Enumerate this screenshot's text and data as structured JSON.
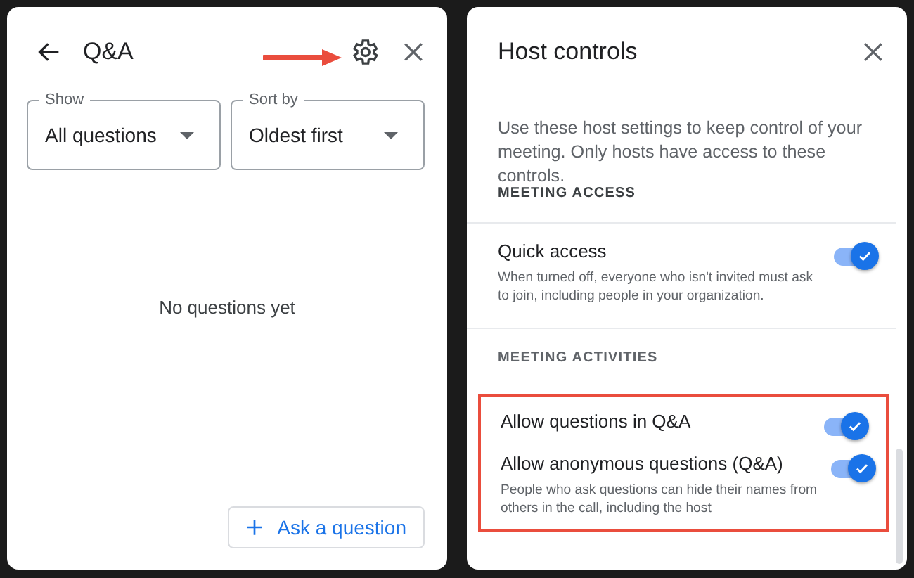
{
  "qa_panel": {
    "title": "Q&A",
    "filters": [
      {
        "label": "Show",
        "value": "All questions"
      },
      {
        "label": "Sort by",
        "value": "Oldest first"
      }
    ],
    "empty_message": "No questions yet",
    "ask_button": "Ask a question"
  },
  "host_panel": {
    "title": "Host controls",
    "intro": "Use these host settings to keep control of your meeting. Only hosts have access to these controls.",
    "sections": [
      {
        "heading": "MEETING ACCESS",
        "highlighted": false,
        "settings": [
          {
            "label": "Quick access",
            "description": "When turned off, everyone who isn't invited must ask to join, including people in your organization.",
            "on": true
          }
        ]
      },
      {
        "heading": "MEETING ACTIVITIES",
        "highlighted": true,
        "settings": [
          {
            "label": "Allow questions in Q&A",
            "on": true
          },
          {
            "label": "Allow anonymous questions (Q&A)",
            "description": "People who ask questions can hide their names from others in the call, including the host",
            "on": true
          }
        ]
      }
    ]
  }
}
